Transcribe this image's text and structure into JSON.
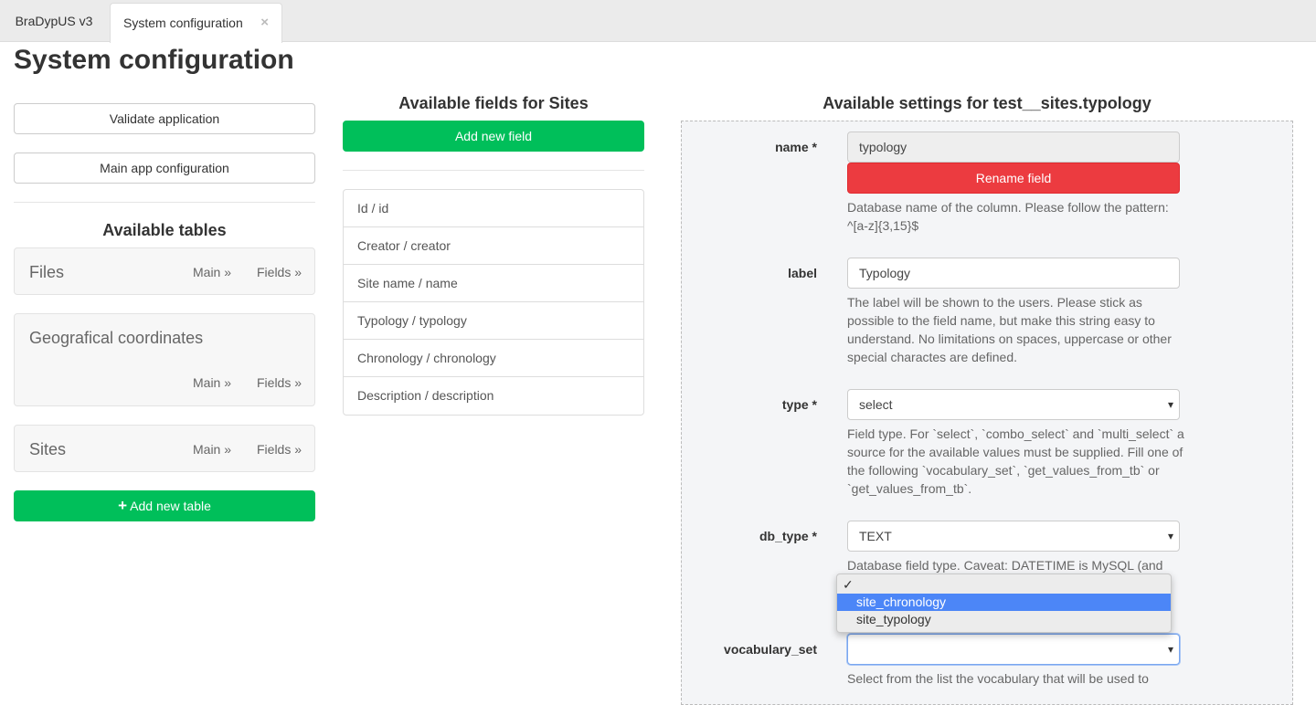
{
  "tabs": [
    {
      "label": "BraDypUS v3"
    },
    {
      "label": "System configuration",
      "close": "×"
    }
  ],
  "page_title": "System configuration",
  "left": {
    "validate": "Validate application",
    "main_config": "Main app configuration",
    "tables_title": "Available tables",
    "tables": [
      {
        "name": "Files",
        "main": "Main »",
        "fields": "Fields »"
      },
      {
        "name": "Geografical coordinates",
        "main": "Main »",
        "fields": "Fields »"
      },
      {
        "name": "Sites",
        "main": "Main »",
        "fields": "Fields »"
      }
    ],
    "add_table": "Add new table",
    "add_icon": "plus-icon"
  },
  "middle": {
    "title": "Available fields for Sites",
    "add_field": "Add new field",
    "fields": [
      "Id / id",
      "Creator / creator",
      "Site name / name",
      "Typology / typology",
      "Chronology / chronology",
      "Description / description"
    ]
  },
  "right": {
    "title": "Available settings for test__sites.typology",
    "name": {
      "label": "name *",
      "value": "typology",
      "rename": "Rename field",
      "help": "Database name of the column. Please follow the pattern: ^[a-z]{3,15}$"
    },
    "label": {
      "label": "label",
      "value": "Typology",
      "help": "The label will be shown to the users. Please stick as possible to the field name, but make this string easy to understand. No limitations on spaces, uppercase or other special charactes are defined."
    },
    "type": {
      "label": "type *",
      "value": "select",
      "help": "Field type. For `select`, `combo_select` and `multi_select` a source for the available values must be supplied. Fill one of the following `vocabulary_set`, `get_values_from_tb` or `get_values_from_tb`."
    },
    "db_type": {
      "label": "db_type *",
      "value": "TEXT",
      "help": "Database field type. Caveat: DATETIME is MySQL (and"
    },
    "vocabulary_set": {
      "label": "vocabulary_set",
      "value": "",
      "options": [
        "",
        "site_chronology",
        "site_typology"
      ],
      "highlighted": "site_chronology",
      "help": "Select from the list the vocabulary that will be used to"
    }
  },
  "colors": {
    "green": "#00bf5a",
    "red": "#ec3b40",
    "highlight": "#4c86f7"
  }
}
